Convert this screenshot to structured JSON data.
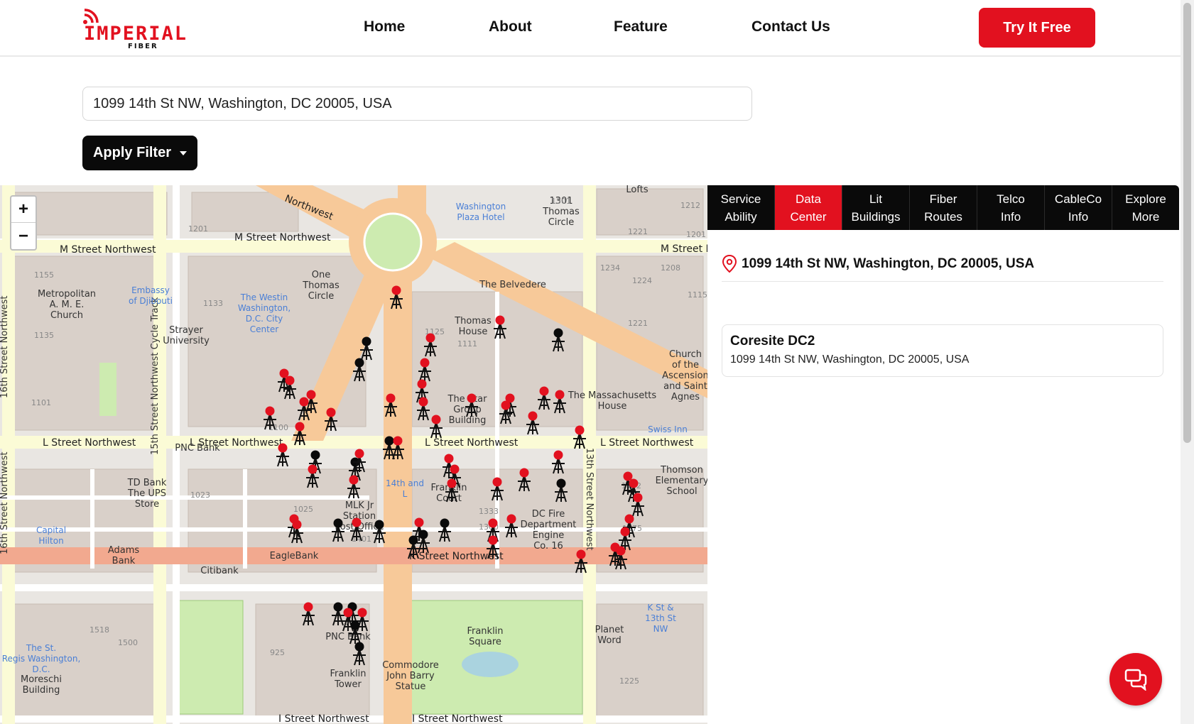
{
  "brand": {
    "name": "IMPERIAL",
    "sub": "FIBER",
    "color": "#e2111f"
  },
  "nav": {
    "home": "Home",
    "about": "About",
    "feature": "Feature",
    "contact": "Contact Us",
    "cta": "Try It Free"
  },
  "search": {
    "value": "1099 14th St NW, Washington, DC 20005, USA"
  },
  "filter": {
    "label": "Apply Filter"
  },
  "map": {
    "zoom_in": "+",
    "zoom_out": "−",
    "streets": {
      "m_street": "M Street Northwest",
      "m_street_2": "M Street Northwest",
      "m_street_3": "M Street N",
      "l_street_1": "L Street Northwest",
      "l_street_2": "L Street Northwest",
      "l_street_3": "L Street Northwest",
      "l_street_4": "L Street Northwest",
      "k_street": "K Street Northwest",
      "i_street_1": "I Street Northwest",
      "i_street_2": "I Street Northwest",
      "northwest": "Northwest",
      "th16": "16th Street Northwest",
      "th16b": "16th Street Northwest",
      "th13": "13th Street Northwest",
      "cycle": "15th Street Northwest Cycle Track"
    },
    "places": {
      "metropolitan": [
        "Metropolitan",
        "A. M. E.",
        "Church"
      ],
      "embassy": [
        "Embassy",
        "of Djibouti"
      ],
      "westin": [
        "The Westin",
        "Washington,",
        "D.C. City",
        "Center"
      ],
      "one_thomas": [
        "One",
        "Thomas",
        "Circle"
      ],
      "strayer": [
        "Strayer",
        "University"
      ],
      "washington_plaza": [
        "Washington",
        "Plaza Hotel"
      ],
      "thomas_circle": [
        "1301",
        "Thomas",
        "Circle"
      ],
      "belvedere": "The Belvedere",
      "thomas_house": [
        "Thomas",
        "House"
      ],
      "star_group": [
        "The Star",
        "Group",
        "Building"
      ],
      "massachusetts": [
        "The Massachusetts",
        "House"
      ],
      "church_asc": [
        "Church",
        "of the",
        "Ascension",
        "and Saint",
        "Agnes"
      ],
      "swiss": "Swiss Inn",
      "td_bank": [
        "TD Bank",
        "The UPS",
        "Store"
      ],
      "capital_hilton": [
        "Capital",
        "Hilton"
      ],
      "adams_bank": [
        "Adams",
        "Bank"
      ],
      "eaglebank": "EagleBank",
      "citibank": "Citibank",
      "pnc_bank": "PNC Bank",
      "pnc_bank_2": "PNC Bank",
      "th14_l": [
        "14th and",
        "L"
      ],
      "franklin_court": [
        "Franklin",
        "Court"
      ],
      "mlk": [
        "MLK Jr",
        "Station",
        "Post Office"
      ],
      "dc_fire": [
        "DC Fire",
        "Department",
        "Engine",
        "Co. 16"
      ],
      "thomson": [
        "Thomson",
        "Elementary",
        "School"
      ],
      "franklin_square": [
        "Franklin",
        "Square"
      ],
      "commodore": [
        "Commodore",
        "John Barry",
        "Statue"
      ],
      "planet_word": [
        "Planet",
        "Word"
      ],
      "kst_13": [
        "K St &",
        "13th St",
        "NW"
      ],
      "st_regis": [
        "The St.",
        "Regis Washington,",
        "D.C."
      ],
      "moreschi": [
        "Moreschi",
        "Building"
      ],
      "franklin_tower": [
        "Franklin",
        "Tower"
      ],
      "lofts": "Lofts"
    },
    "numbers": [
      "1155",
      "1135",
      "1101",
      "1201",
      "1133",
      "1100",
      "1023",
      "1025",
      "1401",
      "1518",
      "1500",
      "925",
      "1234",
      "1208",
      "1224",
      "1221",
      "1221",
      "1212",
      "1201",
      "1111",
      "1225",
      "1301",
      "1333",
      "1300",
      "1175",
      "1172",
      "1125",
      "1115"
    ]
  },
  "tabs": [
    {
      "line1": "Service",
      "line2": "Ability"
    },
    {
      "line1": "Data",
      "line2": "Center"
    },
    {
      "line1": "Lit",
      "line2": "Buildings"
    },
    {
      "line1": "Fiber",
      "line2": "Routes"
    },
    {
      "line1": "Telco",
      "line2": "Info"
    },
    {
      "line1": "CableCo",
      "line2": "Info"
    },
    {
      "line1": "Explore",
      "line2": "More"
    }
  ],
  "panel": {
    "address": "1099 14th St NW, Washington, DC 20005, USA",
    "result": {
      "name": "Coresite DC2",
      "address": "1099 14th St NW, Washington, DC 20005, USA"
    }
  },
  "colors": {
    "accent": "#e2111f",
    "dark": "#0a0a0a",
    "road_major": "#f7c999",
    "road_k": "#f2a98f",
    "park": "#cdebb0",
    "building": "#d9d0c9"
  },
  "icons": {
    "location": "map-pin-icon",
    "chat": "chat-icon",
    "caret": "caret-down-icon"
  }
}
